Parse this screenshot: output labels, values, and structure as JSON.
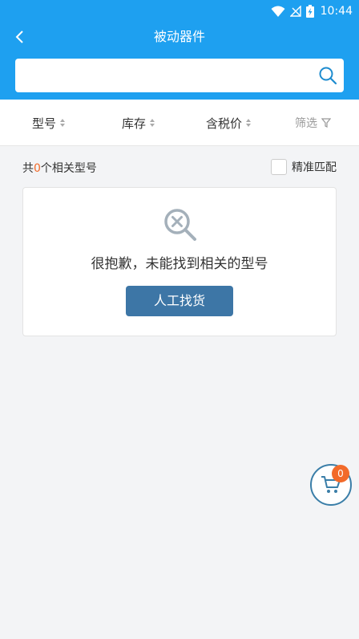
{
  "status_bar": {
    "time": "10:44"
  },
  "nav": {
    "title": "被动器件"
  },
  "search": {
    "value": "",
    "placeholder": ""
  },
  "sort_bar": {
    "items": [
      {
        "label": "型号"
      },
      {
        "label": "库存"
      },
      {
        "label": "含税价"
      }
    ],
    "filter_label": "筛选"
  },
  "result": {
    "prefix": "共",
    "count": "0",
    "suffix": "个相关型号",
    "exact_match_label": "精准匹配"
  },
  "empty_state": {
    "message": "很抱歉，未能找到相关的型号",
    "button_label": "人工找货"
  },
  "cart": {
    "count": "0"
  },
  "colors": {
    "header": "#1ea0f0",
    "accent": "#f26a2a",
    "button": "#3d76a6",
    "cart_border": "#3a7ea8"
  }
}
